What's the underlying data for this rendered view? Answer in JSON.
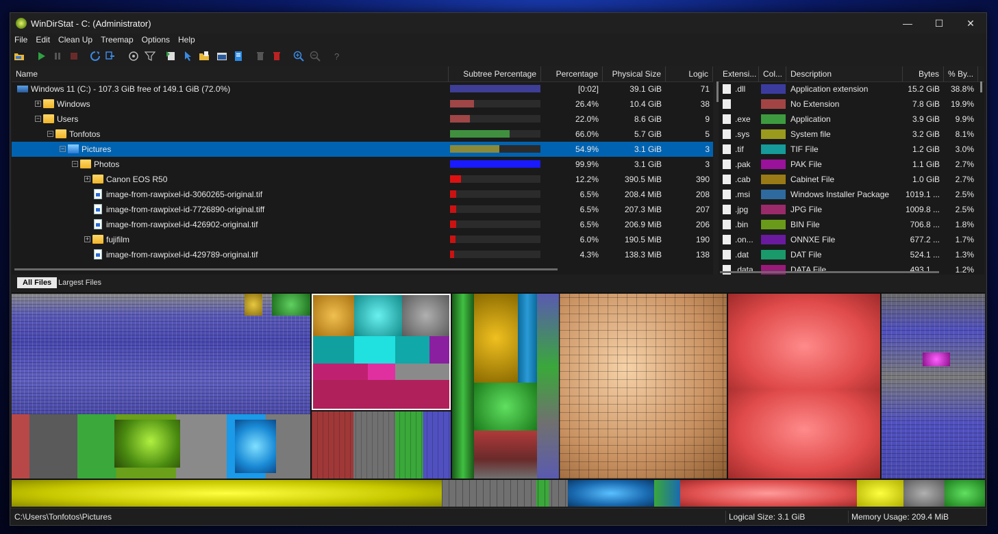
{
  "window": {
    "title": "WinDirStat - C:  (Administrator)",
    "controls": {
      "minimize": "—",
      "maximize": "☐",
      "close": "✕"
    }
  },
  "menu": [
    "File",
    "Edit",
    "Clean Up",
    "Treemap",
    "Options",
    "Help"
  ],
  "toolbar": {
    "icons": [
      "open-icon",
      "play-icon",
      "pause-icon",
      "stop-icon",
      "refresh-icon",
      "refresh-selected-icon",
      "zoom-icon",
      "filter-icon",
      "copy-path-icon",
      "select-icon",
      "explorer-icon",
      "cmd-icon",
      "properties-icon",
      "delete-recycle-icon",
      "delete-icon",
      "zoom-in-icon",
      "zoom-out-icon",
      "help-icon"
    ]
  },
  "tree": {
    "columns": [
      "Name",
      "Subtree Percentage",
      "Percentage",
      "Physical Size",
      "Logic"
    ],
    "rows": [
      {
        "name": "Windows 11 (C:) - 107.3 GiB free of 149.1 GiB (72.0%)",
        "pct": "[0:02]",
        "size": "39.1 GiB",
        "logic": "71",
        "bar": 1.0,
        "color": "#3e3e96",
        "indent": 0,
        "icon": "drive",
        "expand": ""
      },
      {
        "name": "Windows",
        "pct": "26.4%",
        "size": "10.4 GiB",
        "logic": "38",
        "bar": 0.264,
        "color": "#a04646",
        "indent": 1,
        "icon": "folder",
        "expand": "+"
      },
      {
        "name": "Users",
        "pct": "22.0%",
        "size": "8.6 GiB",
        "logic": "9",
        "bar": 0.22,
        "color": "#a04646",
        "indent": 1,
        "icon": "folder",
        "expand": "−"
      },
      {
        "name": "Tonfotos",
        "pct": "66.0%",
        "size": "5.7 GiB",
        "logic": "5",
        "bar": 0.66,
        "color": "#3f8f3f",
        "indent": 2,
        "icon": "folder",
        "expand": "−"
      },
      {
        "name": "Pictures",
        "pct": "54.9%",
        "size": "3.1 GiB",
        "logic": "3",
        "bar": 0.549,
        "color": "#8a8a3a",
        "indent": 3,
        "icon": "pictures",
        "expand": "−",
        "selected": true
      },
      {
        "name": "Photos",
        "pct": "99.9%",
        "size": "3.1 GiB",
        "logic": "3",
        "bar": 0.999,
        "color": "#1a1aff",
        "indent": 4,
        "icon": "folder",
        "expand": "−"
      },
      {
        "name": "Canon EOS R50",
        "pct": "12.2%",
        "size": "390.5 MiB",
        "logic": "390",
        "bar": 0.122,
        "color": "#d11",
        "indent": 5,
        "icon": "folder",
        "expand": "+"
      },
      {
        "name": "image-from-rawpixel-id-3060265-original.tif",
        "pct": "6.5%",
        "size": "208.4 MiB",
        "logic": "208",
        "bar": 0.065,
        "color": "#c11",
        "indent": 5,
        "icon": "file",
        "expand": ""
      },
      {
        "name": "image-from-rawpixel-id-7726890-original.tiff",
        "pct": "6.5%",
        "size": "207.3 MiB",
        "logic": "207",
        "bar": 0.065,
        "color": "#c11",
        "indent": 5,
        "icon": "file",
        "expand": ""
      },
      {
        "name": "image-from-rawpixel-id-426902-original.tif",
        "pct": "6.5%",
        "size": "206.9 MiB",
        "logic": "206",
        "bar": 0.065,
        "color": "#c11",
        "indent": 5,
        "icon": "file",
        "expand": ""
      },
      {
        "name": "fujifilm",
        "pct": "6.0%",
        "size": "190.5 MiB",
        "logic": "190",
        "bar": 0.06,
        "color": "#c11",
        "indent": 5,
        "icon": "folder",
        "expand": "+"
      },
      {
        "name": "image-from-rawpixel-id-429789-original.tif",
        "pct": "4.3%",
        "size": "138.3 MiB",
        "logic": "138",
        "bar": 0.043,
        "color": "#c11",
        "indent": 5,
        "icon": "file",
        "expand": ""
      }
    ]
  },
  "tabs": [
    "All Files",
    "Largest Files"
  ],
  "extensions": {
    "columns": [
      "Extensi...",
      "Col...",
      "Description",
      "Bytes",
      "% By..."
    ],
    "rows": [
      {
        "ext": ".dll",
        "color": "#3b3b9e",
        "desc": "Application extension",
        "bytes": "15.2 GiB",
        "pct": "38.8%"
      },
      {
        "ext": "",
        "color": "#a24444",
        "desc": "No Extension",
        "bytes": "7.8 GiB",
        "pct": "19.9%"
      },
      {
        "ext": ".exe",
        "color": "#3e9a3e",
        "desc": "Application",
        "bytes": "3.9 GiB",
        "pct": "9.9%"
      },
      {
        "ext": ".sys",
        "color": "#9a9a1e",
        "desc": "System file",
        "bytes": "3.2 GiB",
        "pct": "8.1%"
      },
      {
        "ext": ".tif",
        "color": "#169a9a",
        "desc": "TIF File",
        "bytes": "1.2 GiB",
        "pct": "3.0%"
      },
      {
        "ext": ".pak",
        "color": "#9a119a",
        "desc": "PAK File",
        "bytes": "1.1 GiB",
        "pct": "2.7%"
      },
      {
        "ext": ".cab",
        "color": "#9a7a16",
        "desc": "Cabinet File",
        "bytes": "1.0 GiB",
        "pct": "2.7%"
      },
      {
        "ext": ".msi",
        "color": "#2e6a9e",
        "desc": "Windows Installer Package",
        "bytes": "1019.1 ...",
        "pct": "2.5%"
      },
      {
        "ext": ".jpg",
        "color": "#9a2a6a",
        "desc": "JPG File",
        "bytes": "1009.8 ...",
        "pct": "2.5%"
      },
      {
        "ext": ".bin",
        "color": "#6a9a1a",
        "desc": "BIN File",
        "bytes": "706.8 ...",
        "pct": "1.8%"
      },
      {
        "ext": ".on...",
        "color": "#6a1a9e",
        "desc": "ONNXE File",
        "bytes": "677.2 ...",
        "pct": "1.7%"
      },
      {
        "ext": ".dat",
        "color": "#1a9a6a",
        "desc": "DAT File",
        "bytes": "524.1 ...",
        "pct": "1.3%"
      },
      {
        "ext": ".data",
        "color": "#9a1a7a",
        "desc": "DATA File",
        "bytes": "493.1 ...",
        "pct": "1.2%"
      }
    ]
  },
  "status": {
    "path": "C:\\Users\\Tonfotos\\Pictures",
    "logical": "Logical Size: 3.1 GiB",
    "memory": "Memory Usage: 209.4 MiB"
  }
}
